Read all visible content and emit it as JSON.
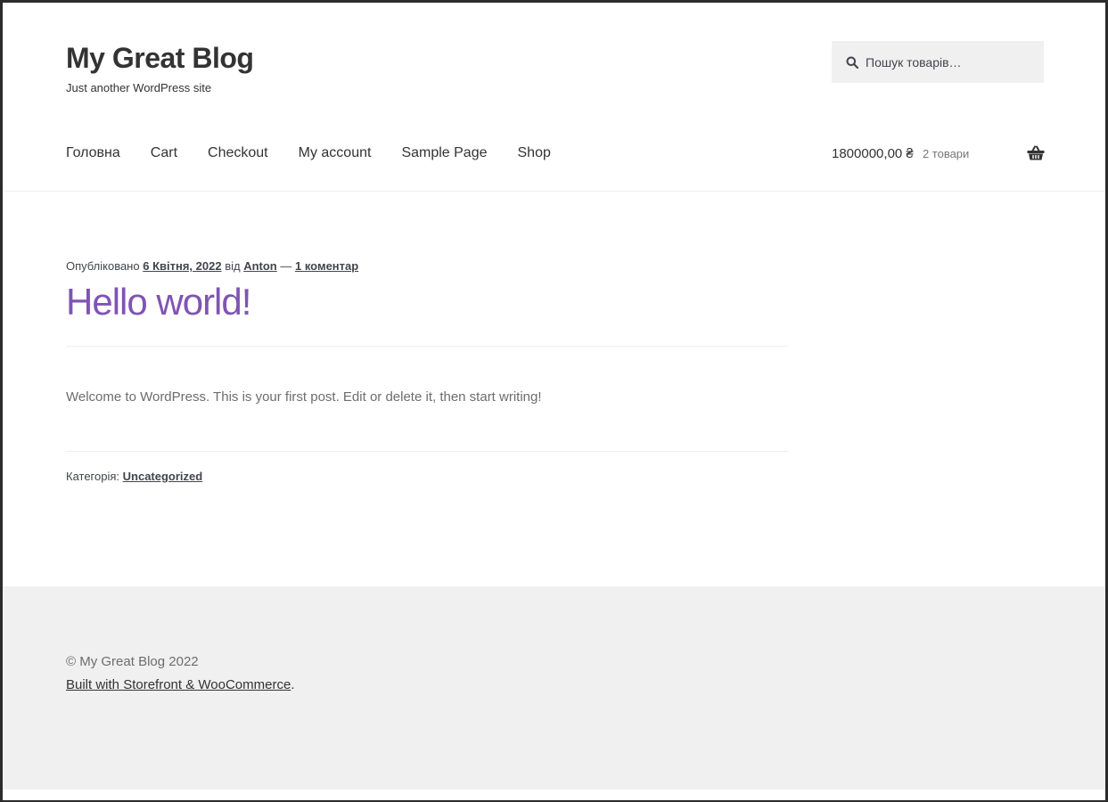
{
  "site": {
    "title": "My Great Blog",
    "tagline": "Just another WordPress site"
  },
  "search": {
    "placeholder": "Пошук товарів…"
  },
  "nav": {
    "items": [
      {
        "label": "Головна"
      },
      {
        "label": "Cart"
      },
      {
        "label": "Checkout"
      },
      {
        "label": "My account"
      },
      {
        "label": "Sample Page"
      },
      {
        "label": "Shop"
      }
    ]
  },
  "cart": {
    "total": "1800000,00 ₴",
    "count": "2 товари"
  },
  "post": {
    "meta_prefix": "Опубліковано",
    "date": "6 Квітня, 2022",
    "by": "від",
    "author": "Anton",
    "dash": "—",
    "comments": "1 коментар",
    "title": "Hello world!",
    "body": "Welcome to WordPress. This is your first post. Edit or delete it, then start writing!",
    "category_label": "Категорія:",
    "category": "Uncategorized"
  },
  "footer": {
    "copyright": "© My Great Blog 2022",
    "credit_link": "Built with Storefront & WooCommerce",
    "credit_suffix": "."
  },
  "colors": {
    "accent": "#7f54b3",
    "footer_bg": "#f0f0f0",
    "search_bg": "#f0f0f0"
  }
}
